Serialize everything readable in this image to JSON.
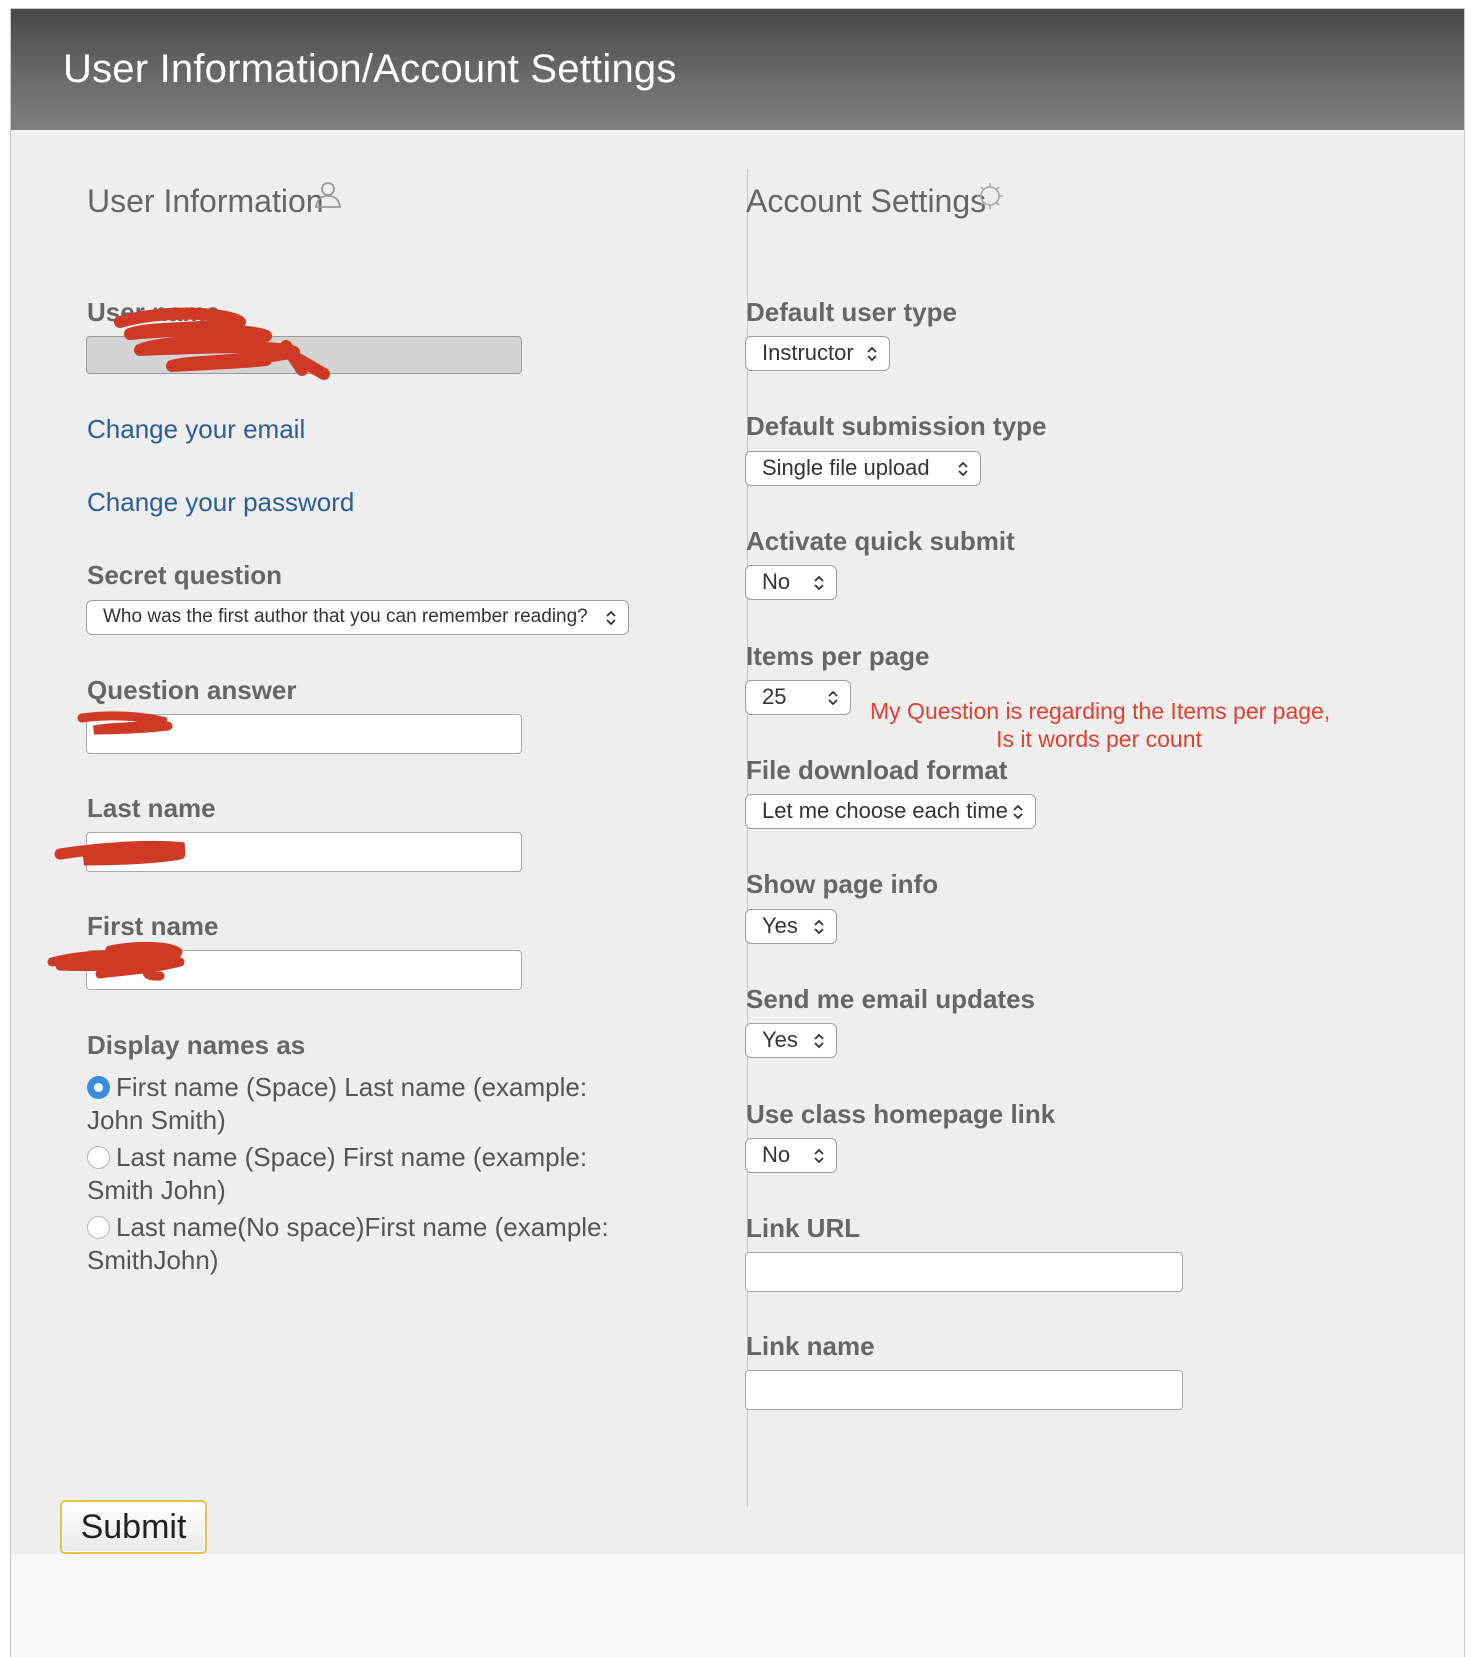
{
  "header": {
    "title": "User Information/Account Settings"
  },
  "user_info": {
    "title": "User Information",
    "title_icon": "user-icon",
    "username_label": "User name",
    "username_value": "",
    "change_email": "Change your email",
    "change_password": "Change your password",
    "secret_question_label": "Secret question",
    "secret_question_value": "Who was the first author that you can remember reading?",
    "question_answer_label": "Question answer",
    "question_answer_value": "",
    "last_name_label": "Last name",
    "last_name_value": "",
    "first_name_label": "First name",
    "first_name_value": "",
    "display_names_label": "Display names as",
    "display_options": [
      {
        "label": "First name (Space) Last name (example: John Smith)",
        "checked": true
      },
      {
        "label": "Last name (Space) First name (example: Smith John)",
        "checked": false
      },
      {
        "label": "Last name(No space)First name (example: SmithJohn)",
        "checked": false
      }
    ]
  },
  "account_settings": {
    "title": "Account Settings",
    "title_icon": "gear-icon",
    "default_user_type_label": "Default user type",
    "default_user_type_value": "Instructor",
    "default_submission_type_label": "Default submission type",
    "default_submission_type_value": "Single file upload",
    "activate_quick_submit_label": "Activate quick submit",
    "activate_quick_submit_value": "No",
    "items_per_page_label": "Items per page",
    "items_per_page_value": "25",
    "file_download_format_label": "File download format",
    "file_download_format_value": "Let me choose each time",
    "show_page_info_label": "Show page info",
    "show_page_info_value": "Yes",
    "send_email_updates_label": "Send me email updates",
    "send_email_updates_value": "Yes",
    "use_class_homepage_link_label": "Use class homepage link",
    "use_class_homepage_link_value": "No",
    "link_url_label": "Link URL",
    "link_url_value": "",
    "link_name_label": "Link name",
    "link_name_value": ""
  },
  "annotation": {
    "line1": "My Question is regarding the Items per page,",
    "line2": "Is it words per count",
    "color": "#e0402f"
  },
  "footer": {
    "submit_label": "Submit",
    "accent_color": "#e8c04c"
  },
  "colors": {
    "link": "#2b5d96",
    "radio_checked": "#3a8dde",
    "redaction": "#cf3a26"
  }
}
